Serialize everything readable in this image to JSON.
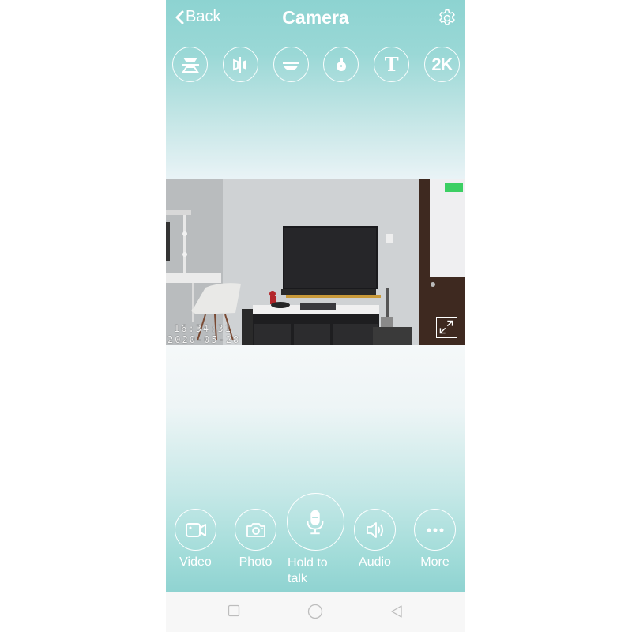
{
  "header": {
    "back_label": "Back",
    "title": "Camera",
    "settings_icon": "gear-icon"
  },
  "toolbar": {
    "items": [
      {
        "name": "flip-vertical",
        "icon": "flip-vertical-icon"
      },
      {
        "name": "mirror",
        "icon": "mirror-icon"
      },
      {
        "name": "ceiling-mount",
        "icon": "ceiling-mount-icon"
      },
      {
        "name": "night-light",
        "icon": "bulb-icon"
      },
      {
        "name": "text-overlay",
        "label": "T",
        "icon": "text-icon"
      },
      {
        "name": "resolution",
        "label": "2K",
        "icon": "resolution-icon"
      }
    ]
  },
  "video": {
    "time": "16:34:31",
    "date": "2020-05-28",
    "signal_color": "#3ccf63"
  },
  "controls": [
    {
      "name": "video",
      "label": "Video",
      "icon": "video-camera-icon"
    },
    {
      "name": "photo",
      "label": "Photo",
      "icon": "camera-icon"
    },
    {
      "name": "talk",
      "label": "Hold to talk",
      "icon": "microphone-icon"
    },
    {
      "name": "audio",
      "label": "Audio",
      "icon": "speaker-icon"
    },
    {
      "name": "more",
      "label": "More",
      "icon": "more-icon"
    }
  ],
  "navbar": {
    "recent": "recent-apps-icon",
    "home": "home-icon",
    "back": "back-triangle-icon"
  },
  "colors": {
    "accent": "#8dd3d1",
    "navbar_bg": "#f7f7f7"
  }
}
